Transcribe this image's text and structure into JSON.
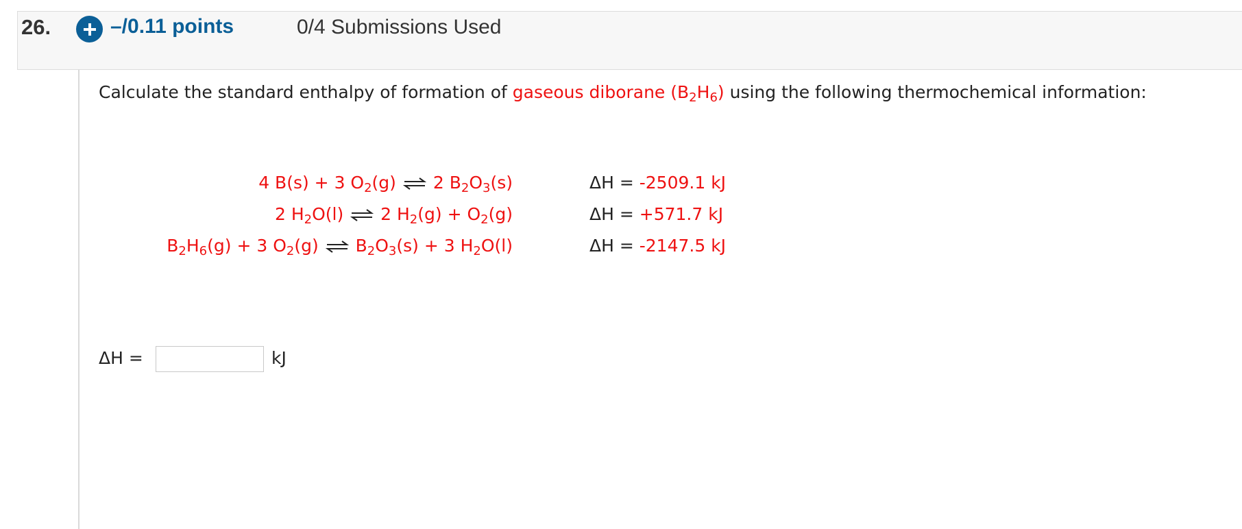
{
  "header": {
    "question_number": "26.",
    "points": "–/0.11 points",
    "submissions": "0/4 Submissions Used"
  },
  "prompt": {
    "before": "Calculate the standard enthalpy of formation of ",
    "highlight": "gaseous diborane (B",
    "sub1": "2",
    "mid": "H",
    "sub2": "6",
    "close": ")",
    "after": " using the following thermochemical information:"
  },
  "reactions": [
    {
      "lhs": [
        "4 B(s) + 3 O",
        "2",
        "(g)"
      ],
      "rhs": [
        "2 B",
        "2",
        "O",
        "3",
        "(s)"
      ],
      "dh_label": "ΔH = ",
      "dh_value": "-2509.1 kJ"
    },
    {
      "lhs": [
        "2 H",
        "2",
        "O(l)"
      ],
      "rhs": [
        "2 H",
        "2",
        "(g) + O",
        "2",
        "(g)"
      ],
      "dh_label": "ΔH = ",
      "dh_value": "+571.7 kJ"
    },
    {
      "lhs": [
        "B",
        "2",
        "H",
        "6",
        "(g) + 3 O",
        "2",
        "(g)"
      ],
      "rhs": [
        "B",
        "2",
        "O",
        "3",
        "(s) + 3 H",
        "2",
        "O(l)"
      ],
      "dh_label": "ΔH = ",
      "dh_value": "-2147.5 kJ"
    }
  ],
  "answer": {
    "label": "ΔH =",
    "value": "",
    "unit": "kJ"
  },
  "colors": {
    "accent": "#0b5f97",
    "highlight": "#ee1111"
  }
}
